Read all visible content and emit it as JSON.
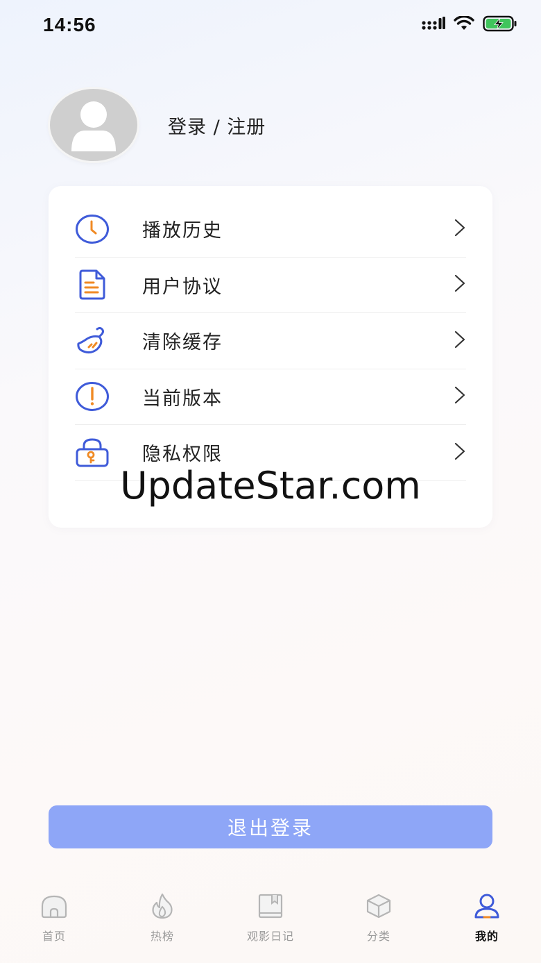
{
  "status_bar": {
    "time": "14:56",
    "icons": [
      "signal-icon",
      "wifi-icon",
      "battery-charging-icon"
    ]
  },
  "profile": {
    "login_label": "登录 / 注册",
    "avatar_icon": "user-avatar-icon"
  },
  "menu": {
    "items": [
      {
        "label": "播放历史",
        "icon": "clock-icon"
      },
      {
        "label": "用户协议",
        "icon": "document-icon"
      },
      {
        "label": "清除缓存",
        "icon": "broom-icon"
      },
      {
        "label": "当前版本",
        "icon": "info-icon"
      },
      {
        "label": "隐私权限",
        "icon": "lock-key-icon"
      }
    ]
  },
  "watermark": "UpdateStar.com",
  "logout": {
    "label": "退出登录"
  },
  "tabbar": {
    "tabs": [
      {
        "label": "首页",
        "icon": "home-icon",
        "active": false
      },
      {
        "label": "热榜",
        "icon": "flame-icon",
        "active": false
      },
      {
        "label": "观影日记",
        "icon": "book-icon",
        "active": false
      },
      {
        "label": "分类",
        "icon": "cube-icon",
        "active": false
      },
      {
        "label": "我的",
        "icon": "user-icon",
        "active": true
      }
    ]
  },
  "colors": {
    "accent_blue": "#3f5bd9",
    "accent_orange": "#f08a24",
    "logout_bg": "#8ea6f7",
    "inactive_tab": "#9a9a9a"
  }
}
